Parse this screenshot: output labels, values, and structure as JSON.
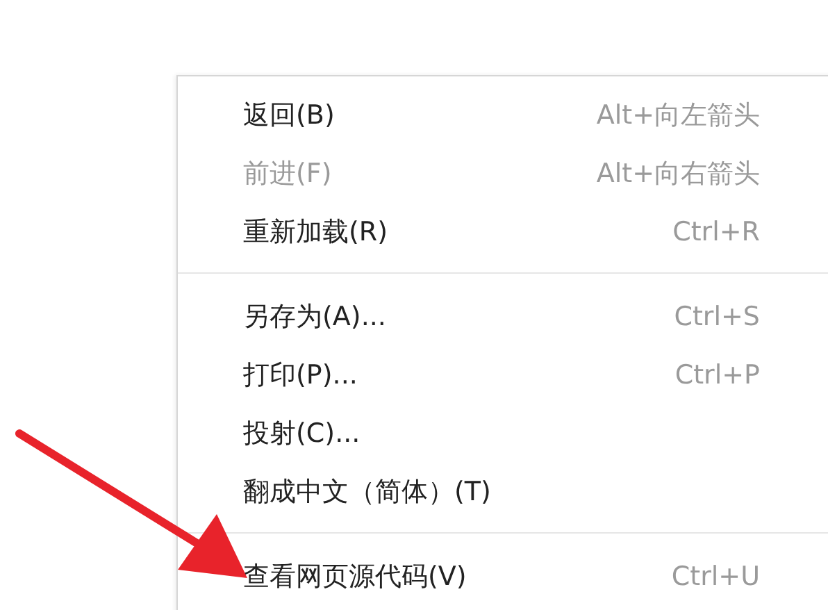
{
  "context_menu": {
    "groups": [
      {
        "items": [
          {
            "label": "返回(B)",
            "shortcut": "Alt+向左箭头",
            "disabled": false
          },
          {
            "label": "前进(F)",
            "shortcut": "Alt+向右箭头",
            "disabled": true
          },
          {
            "label": "重新加载(R)",
            "shortcut": "Ctrl+R",
            "disabled": false
          }
        ]
      },
      {
        "items": [
          {
            "label": "另存为(A)...",
            "shortcut": "Ctrl+S",
            "disabled": false
          },
          {
            "label": "打印(P)...",
            "shortcut": "Ctrl+P",
            "disabled": false
          },
          {
            "label": "投射(C)...",
            "disabled": false
          },
          {
            "label": "翻成中文（简体）(T)",
            "disabled": false
          }
        ]
      },
      {
        "items": [
          {
            "label": "查看网页源代码(V)",
            "shortcut": "Ctrl+U",
            "disabled": false
          }
        ]
      }
    ]
  }
}
